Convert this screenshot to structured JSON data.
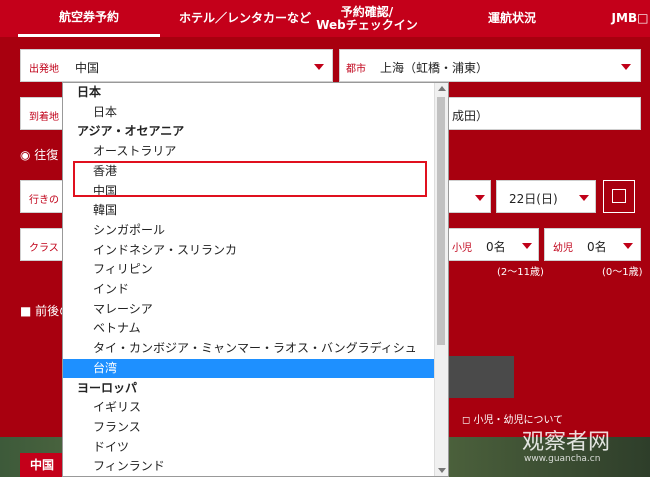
{
  "tabs": [
    {
      "label": "航空券予約"
    },
    {
      "label": "ホテル／レンタカーなど"
    },
    {
      "label_line1": "予約確認/",
      "label_line2": "Webチェックイン"
    },
    {
      "label": "運航状況"
    },
    {
      "label": "JMB□"
    }
  ],
  "form": {
    "origin_label": "出発地",
    "origin_value": "中国",
    "city_label": "都市",
    "city_value": "上海（虹橋・浦東）",
    "dest_label": "到着地",
    "dest_city_value": "成田）",
    "roundtrip_label": "往復",
    "outbound_label": "行きの",
    "date_value": "22日(日)",
    "class_label": "クラス",
    "child_label": "小児",
    "child_value": "0名",
    "child_age": "(2〜11歳)",
    "infant_label": "幼児",
    "infant_value": "0名",
    "infant_age": "(0〜1歳)",
    "flex_label": "前後の",
    "child_info_link": "小児・幼児について",
    "bottom_badge": "中国"
  },
  "watermark": {
    "main": "观察者网",
    "sub": "www.guancha.cn"
  },
  "dropdown": {
    "items": [
      {
        "type": "group",
        "label": "日本"
      },
      {
        "type": "child",
        "label": "日本"
      },
      {
        "type": "group",
        "label": "アジア・オセアニア"
      },
      {
        "type": "child",
        "label": "オーストラリア"
      },
      {
        "type": "child",
        "label": "香港"
      },
      {
        "type": "child",
        "label": "中国"
      },
      {
        "type": "child",
        "label": "韓国"
      },
      {
        "type": "child",
        "label": "シンガポール"
      },
      {
        "type": "child",
        "label": "インドネシア・スリランカ"
      },
      {
        "type": "child",
        "label": "フィリピン"
      },
      {
        "type": "child",
        "label": "インド"
      },
      {
        "type": "child",
        "label": "マレーシア"
      },
      {
        "type": "child",
        "label": "ベトナム"
      },
      {
        "type": "child",
        "label": "タイ・カンボジア・ミャンマー・ラオス・バングラディシュ"
      },
      {
        "type": "child",
        "label": "台湾",
        "selected": true
      },
      {
        "type": "group",
        "label": "ヨーロッパ"
      },
      {
        "type": "child",
        "label": "イギリス"
      },
      {
        "type": "child",
        "label": "フランス"
      },
      {
        "type": "child",
        "label": "ドイツ"
      },
      {
        "type": "child",
        "label": "フィンランド"
      }
    ]
  }
}
